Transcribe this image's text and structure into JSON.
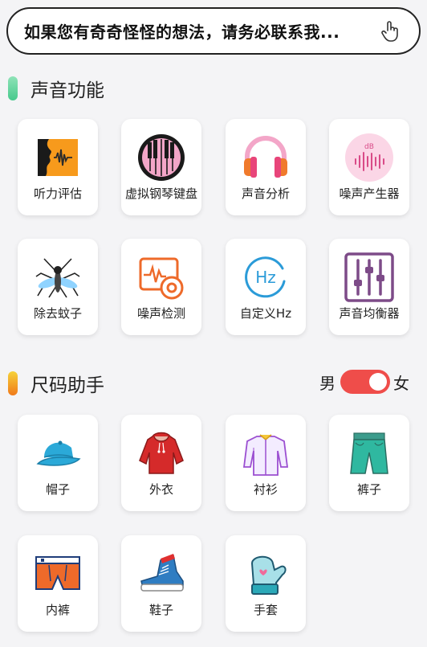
{
  "search": {
    "text": "如果您有奇奇怪怪的想法，请务必联系我..."
  },
  "sections": {
    "sound": {
      "title": "声音功能"
    },
    "size": {
      "title": "尺码助手"
    }
  },
  "sound_items": [
    {
      "label": "听力评估",
      "icon": "hearing-test-icon"
    },
    {
      "label": "虚拟钢琴键盘",
      "icon": "piano-icon"
    },
    {
      "label": "声音分析",
      "icon": "headphones-icon"
    },
    {
      "label": "噪声产生器",
      "icon": "db-wave-icon"
    },
    {
      "label": "除去蚊子",
      "icon": "mosquito-icon"
    },
    {
      "label": "噪声检测",
      "icon": "noise-monitor-icon"
    },
    {
      "label": "自定义Hz",
      "icon": "hz-icon",
      "icon_text": "Hz"
    },
    {
      "label": "声音均衡器",
      "icon": "equalizer-icon"
    }
  ],
  "size_items": [
    {
      "label": "帽子",
      "icon": "cap-icon"
    },
    {
      "label": "外衣",
      "icon": "hoodie-icon"
    },
    {
      "label": "衬衫",
      "icon": "shirt-icon"
    },
    {
      "label": "裤子",
      "icon": "shorts-icon"
    },
    {
      "label": "内裤",
      "icon": "underwear-icon"
    },
    {
      "label": "鞋子",
      "icon": "sneaker-icon"
    },
    {
      "label": "手套",
      "icon": "mitten-icon"
    }
  ],
  "gender": {
    "male": "男",
    "female": "女",
    "selected": "女"
  },
  "icon_texts": {
    "db": "dB"
  },
  "colors": {
    "toggle_on": "#ef4d4a",
    "section_green": "#5fd3a0",
    "section_orange": "#f39c12"
  }
}
